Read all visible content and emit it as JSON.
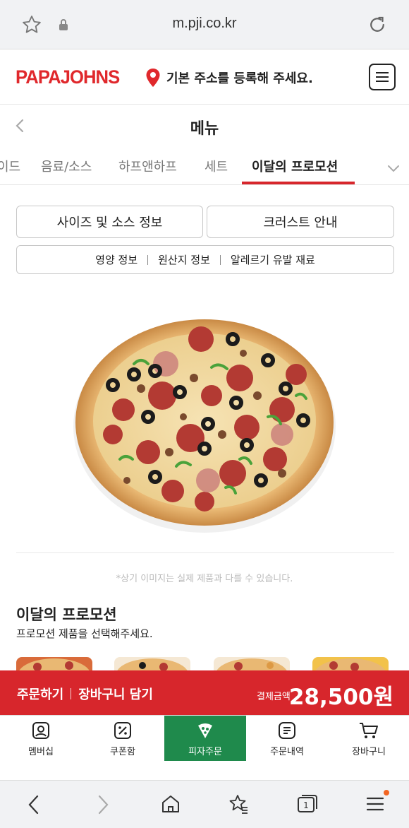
{
  "browser": {
    "url": "m.pji.co.kr",
    "tab_count": "1"
  },
  "header": {
    "logo": "PAPAJOHNS",
    "address_prompt": "기본 주소를 등록해 주세요."
  },
  "page": {
    "title": "메뉴"
  },
  "tabs": [
    {
      "label": "이드"
    },
    {
      "label": "음료/소스"
    },
    {
      "label": "하프앤하프"
    },
    {
      "label": "세트"
    },
    {
      "label": "이달의 프로모션",
      "active": true
    }
  ],
  "info": {
    "size_sauce": "사이즈 및 소스 정보",
    "crust": "크러스트 안내",
    "nutrition": "영양 정보",
    "origin": "원산지 정보",
    "allergy": "알레르기 유발 재료"
  },
  "product": {
    "disclaimer": "*상기 이미지는 실제 제품과 다를 수 있습니다.",
    "section_title": "이달의 프로모션",
    "section_subtitle": "프로모션 제품을 선택해주세요."
  },
  "order": {
    "order_label": "주문하기",
    "cart_add_label": "장바구니 담기",
    "pay_label": "결제금액",
    "amount": "28,500원"
  },
  "bottom_nav": [
    {
      "label": "멤버십",
      "icon": "membership-icon"
    },
    {
      "label": "쿠폰함",
      "icon": "coupon-icon"
    },
    {
      "label": "피자주문",
      "icon": "pizza-slice-icon",
      "active": true
    },
    {
      "label": "주문내역",
      "icon": "order-history-icon"
    },
    {
      "label": "장바구니",
      "icon": "cart-icon"
    }
  ],
  "colors": {
    "brand_red": "#d7262c",
    "active_green": "#1f8a4c"
  }
}
